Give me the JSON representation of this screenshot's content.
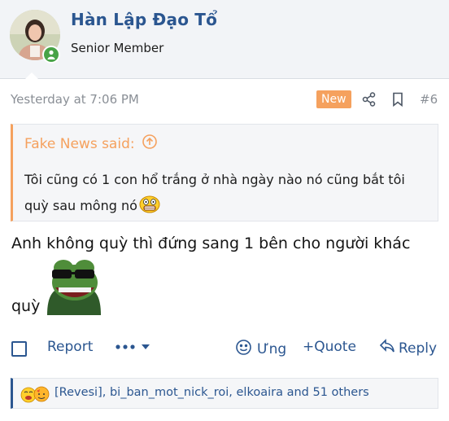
{
  "user": {
    "name": "Hàn Lập Đạo Tổ",
    "title": "Senior Member"
  },
  "meta": {
    "time": "Yesterday at 7:06 PM",
    "badge": "New",
    "post_number": "#6"
  },
  "quote": {
    "author": "Fake News said:",
    "text": "Tôi cũng có 1 con hổ trắng ở nhà ngày nào nó cũng bắt tôi quỳ sau mông nó"
  },
  "message": {
    "line1": "Anh không quỳ thì đứng sang 1 bên cho người khác",
    "line2": "quỳ"
  },
  "actions": {
    "report": "Report",
    "like": "Ưng",
    "quote": "+Quote",
    "reply": "Reply"
  },
  "reactions": {
    "text": "[Revesi], bi_ban_mot_nick_roi, elkoaira and 51 others"
  },
  "colors": {
    "accent": "#2b5690",
    "quote_accent": "#f5a15e",
    "header_bg": "#f2f4f7",
    "muted": "#8a8f96"
  },
  "icons": [
    "online-check-icon",
    "share-icon",
    "bookmark-icon",
    "arrow-up-circle-icon",
    "scared-emoji-icon",
    "pepe-sunglasses-icon",
    "chevron-down-icon",
    "reaction-icon",
    "quote-icon",
    "reply-icon"
  ]
}
